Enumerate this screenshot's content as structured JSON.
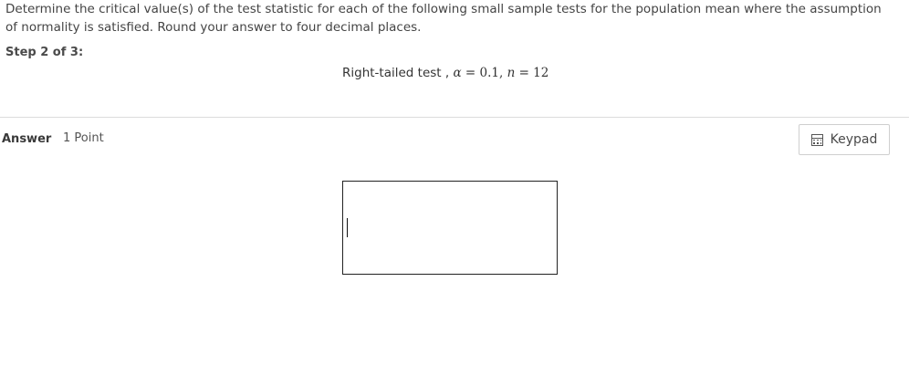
{
  "question": {
    "text": "Determine the critical value(s) of the test statistic for each of the following small sample tests for the population mean where the assumption of normality is satisfied. Round your answer to four decimal places.",
    "step": "Step 2 of 3:",
    "prompt_text": "Right-tailed test ,",
    "alpha_symbol": "α",
    "alpha_value": "= 0.1,",
    "n_symbol": "n",
    "n_value": "= 12"
  },
  "answer": {
    "label": "Answer",
    "points": "1 Point",
    "input_value": ""
  },
  "toolbar": {
    "keypad_label": "Keypad",
    "keypad_icon": "calculator-icon"
  },
  "colors": {
    "divider": "#dcdcdc",
    "input_border": "#222222",
    "text": "#444444"
  }
}
